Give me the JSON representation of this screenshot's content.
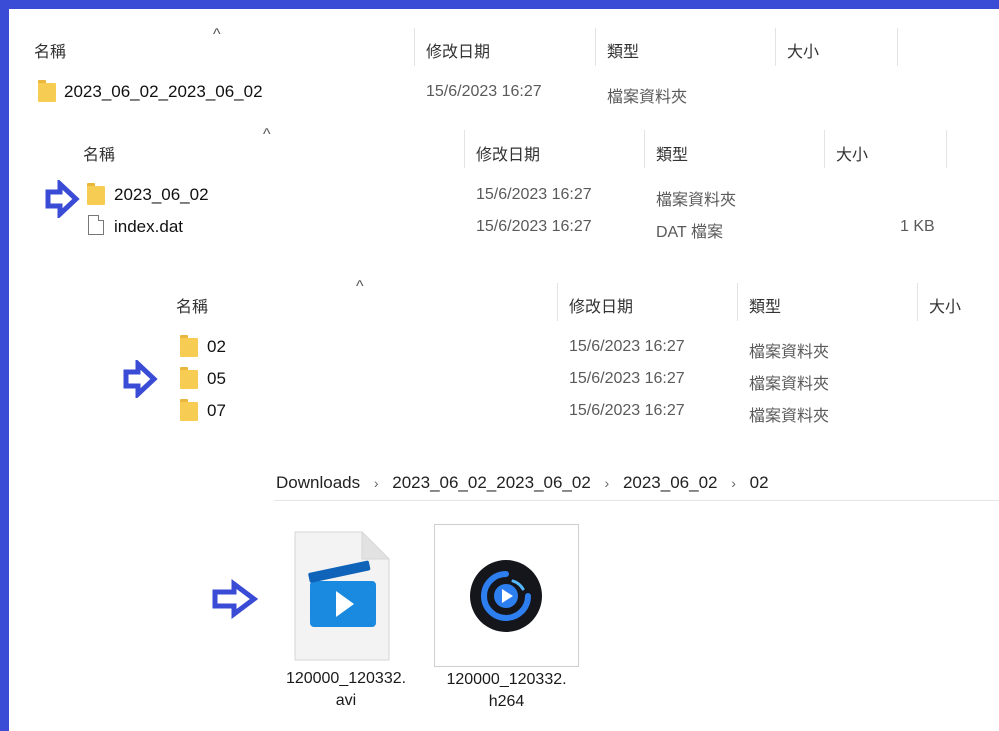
{
  "colors": {
    "accent": "#3a4bd6",
    "folder": "#f6cc53"
  },
  "view1": {
    "headers": {
      "name": "名稱",
      "date": "修改日期",
      "type": "類型",
      "size": "大小"
    },
    "rows": [
      {
        "name": "2023_06_02_2023_06_02",
        "date": "15/6/2023 16:27",
        "type": "檔案資料夾",
        "icon": "folder-icon"
      }
    ]
  },
  "view2": {
    "headers": {
      "name": "名稱",
      "date": "修改日期",
      "type": "類型",
      "size": "大小"
    },
    "rows": [
      {
        "name": "2023_06_02",
        "date": "15/6/2023 16:27",
        "type": "檔案資料夾",
        "size": "",
        "icon": "folder-icon"
      },
      {
        "name": "index.dat",
        "date": "15/6/2023 16:27",
        "type": "DAT 檔案",
        "size": "1 KB",
        "icon": "file-icon"
      }
    ]
  },
  "view3": {
    "headers": {
      "name": "名稱",
      "date": "修改日期",
      "type": "類型",
      "size": "大小"
    },
    "rows": [
      {
        "name": "02",
        "date": "15/6/2023 16:27",
        "type": "檔案資料夾",
        "icon": "folder-icon"
      },
      {
        "name": "05",
        "date": "15/6/2023 16:27",
        "type": "檔案資料夾",
        "icon": "folder-icon"
      },
      {
        "name": "07",
        "date": "15/6/2023 16:27",
        "type": "檔案資料夾",
        "icon": "folder-icon"
      }
    ]
  },
  "breadcrumb": {
    "items": [
      "Downloads",
      "2023_06_02_2023_06_02",
      "2023_06_02",
      "02"
    ],
    "separator": "›"
  },
  "files": [
    {
      "line1": "120000_120332.",
      "line2": "avi",
      "icon": "video-file-icon"
    },
    {
      "line1": "120000_120332.",
      "line2": "h264",
      "icon": "media-player-icon"
    }
  ]
}
